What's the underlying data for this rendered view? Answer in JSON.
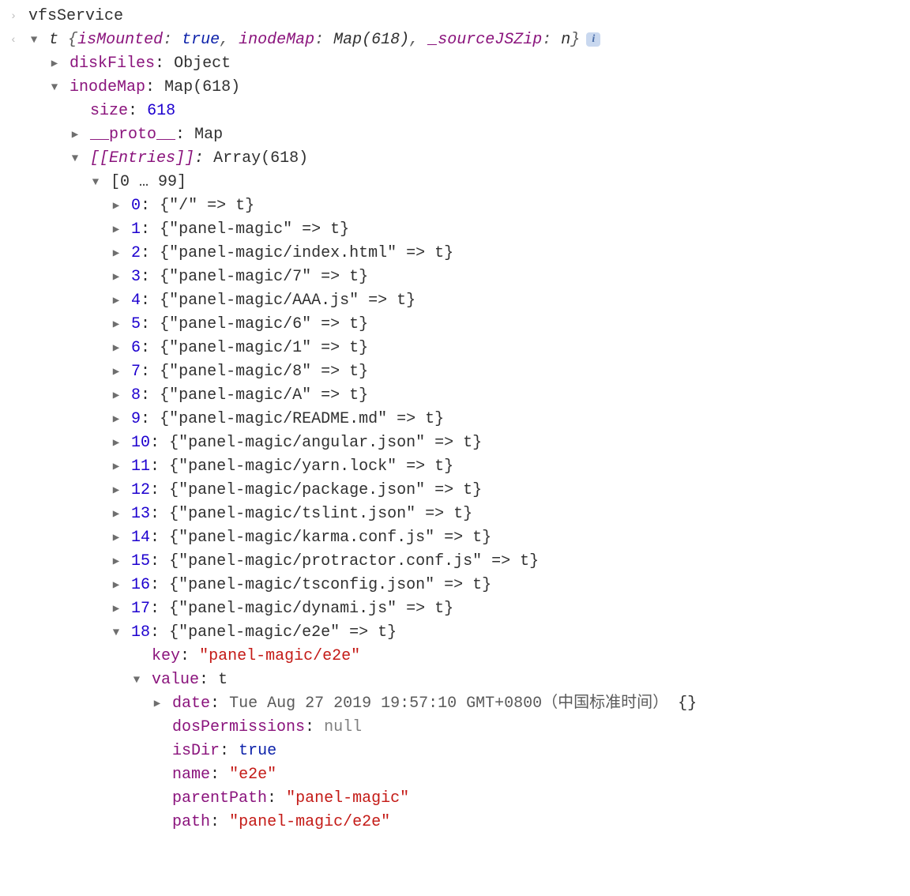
{
  "line_input": {
    "prompt": "›",
    "value": "vfsService"
  },
  "result": {
    "back": "‹",
    "classLetter": "t",
    "summaryPrefix": "{",
    "summarySuffix": "}",
    "summaryProps": {
      "isMounted": "true",
      "inodeMap": "Map(618)",
      "_sourceJSZip": "n"
    },
    "diskFiles": {
      "label": "diskFiles",
      "value": "Object"
    },
    "inodeMap": {
      "label": "inodeMap",
      "value": "Map(618)",
      "size": {
        "label": "size",
        "value": "618"
      },
      "proto": {
        "label": "__proto__",
        "value": "Map"
      },
      "entries": {
        "label": "[[Entries]]",
        "value": "Array(618)",
        "range": "[0 … 99]",
        "items": [
          {
            "idx": "0",
            "text": "{\"/\" => t}"
          },
          {
            "idx": "1",
            "text": "{\"panel-magic\" => t}"
          },
          {
            "idx": "2",
            "text": "{\"panel-magic/index.html\" => t}"
          },
          {
            "idx": "3",
            "text": "{\"panel-magic/7\" => t}"
          },
          {
            "idx": "4",
            "text": "{\"panel-magic/AAA.js\" => t}"
          },
          {
            "idx": "5",
            "text": "{\"panel-magic/6\" => t}"
          },
          {
            "idx": "6",
            "text": "{\"panel-magic/1\" => t}"
          },
          {
            "idx": "7",
            "text": "{\"panel-magic/8\" => t}"
          },
          {
            "idx": "8",
            "text": "{\"panel-magic/A\" => t}"
          },
          {
            "idx": "9",
            "text": "{\"panel-magic/README.md\" => t}"
          },
          {
            "idx": "10",
            "text": "{\"panel-magic/angular.json\" => t}"
          },
          {
            "idx": "11",
            "text": "{\"panel-magic/yarn.lock\" => t}"
          },
          {
            "idx": "12",
            "text": "{\"panel-magic/package.json\" => t}"
          },
          {
            "idx": "13",
            "text": "{\"panel-magic/tslint.json\" => t}"
          },
          {
            "idx": "14",
            "text": "{\"panel-magic/karma.conf.js\" => t}"
          },
          {
            "idx": "15",
            "text": "{\"panel-magic/protractor.conf.js\" => t}"
          },
          {
            "idx": "16",
            "text": "{\"panel-magic/tsconfig.json\" => t}"
          },
          {
            "idx": "17",
            "text": "{\"panel-magic/dynami.js\" => t}"
          }
        ],
        "openItem": {
          "idx": "18",
          "text": "{\"panel-magic/e2e\" => t}",
          "key": {
            "label": "key",
            "value": "\"panel-magic/e2e\""
          },
          "value": {
            "label": "value",
            "class": "t",
            "date": {
              "label": "date",
              "value": "Tue Aug 27 2019 19:57:10 GMT+0800（中国标准时间）",
              "suffix": "{}"
            },
            "dosPermissions": {
              "label": "dosPermissions",
              "value": "null"
            },
            "isDir": {
              "label": "isDir",
              "value": "true"
            },
            "name": {
              "label": "name",
              "value": "\"e2e\""
            },
            "parentPath": {
              "label": "parentPath",
              "value": "\"panel-magic\""
            },
            "path": {
              "label": "path",
              "value": "\"panel-magic/e2e\""
            }
          }
        }
      }
    }
  }
}
